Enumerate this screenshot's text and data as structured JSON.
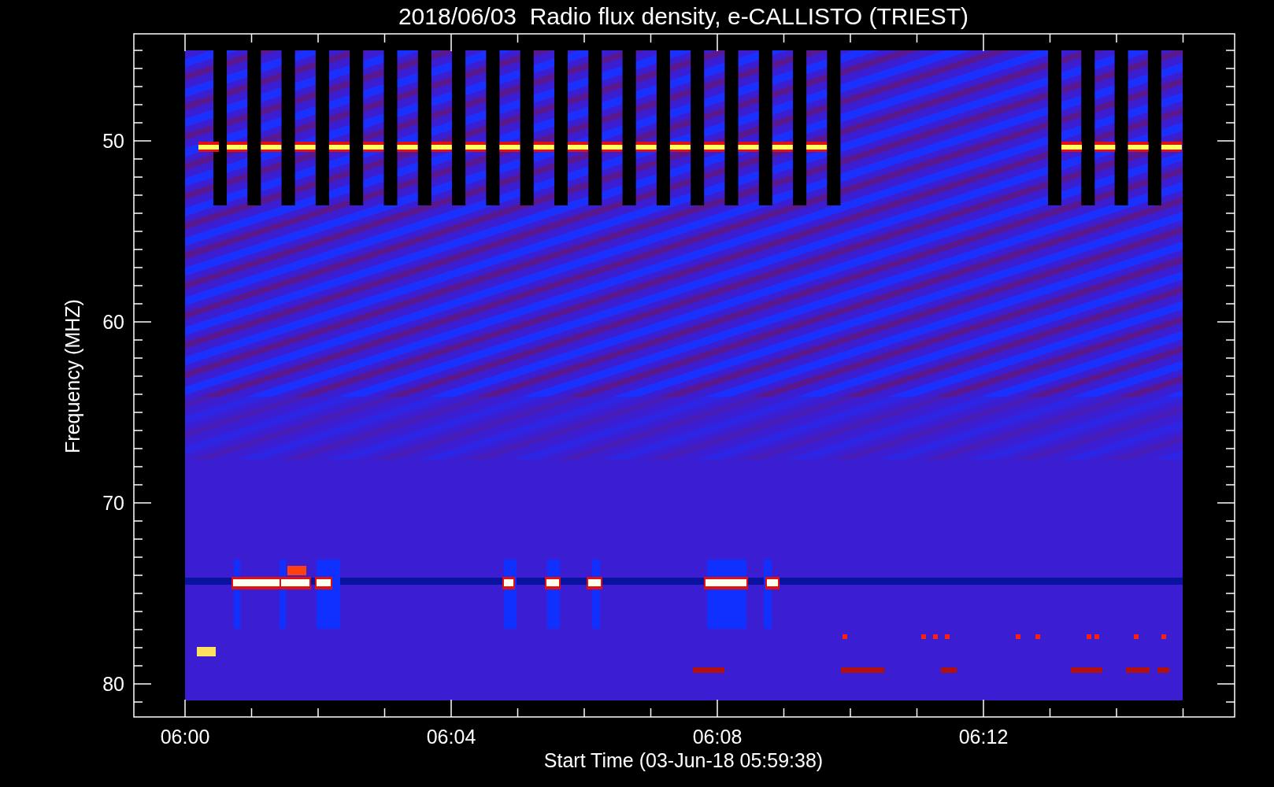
{
  "plot": {
    "title": "2018/06/03  Radio flux density, e-CALLISTO (TRIEST)",
    "xlabel": "Start Time (03-Jun-18 05:59:38)",
    "ylabel": "Frequency (MHZ)",
    "xticks": [
      "06:00",
      "06:04",
      "06:08",
      "06:12"
    ],
    "yticks": [
      "50",
      "60",
      "70",
      "80"
    ]
  }
}
